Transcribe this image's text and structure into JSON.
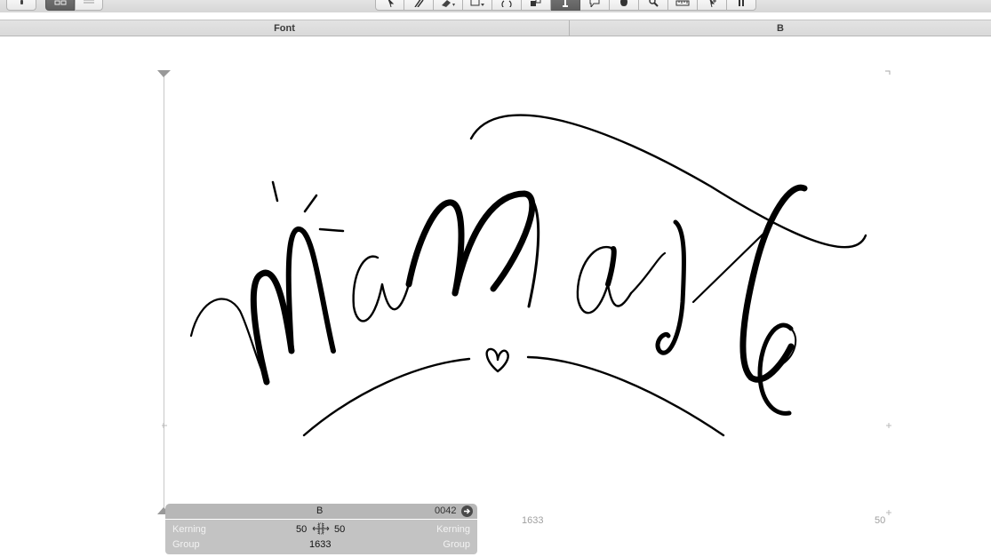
{
  "tabs": {
    "font": "Font",
    "glyph": "B"
  },
  "metrics": {
    "width_value": "1633",
    "rsb_value": "50"
  },
  "panel": {
    "glyph_name": "B",
    "unicode": "0042",
    "left_kerning_label": "Kerning",
    "right_kerning_label": "Kerning",
    "left_group_label": "Group",
    "right_group_label": "Group",
    "left_sidebearing": "50",
    "right_sidebearing": "50",
    "width": "1633"
  },
  "icons": [
    "sidebar-toggle-icon",
    "grid-view-icon",
    "list-view-icon",
    "select-arrow-icon",
    "pen-icon",
    "eraser-icon",
    "rectangle-icon",
    "rotate-icon",
    "components-icon",
    "text-tool-icon",
    "speech-bubble-icon",
    "hand-icon",
    "zoom-icon",
    "measure-icon",
    "pointer-plus-icon",
    "pause-icon",
    "arrow-circle-icon"
  ],
  "colors": {
    "accent_active": "#666666",
    "panel_bg": "#c3c3c3",
    "glyph_fill": "#000000"
  }
}
